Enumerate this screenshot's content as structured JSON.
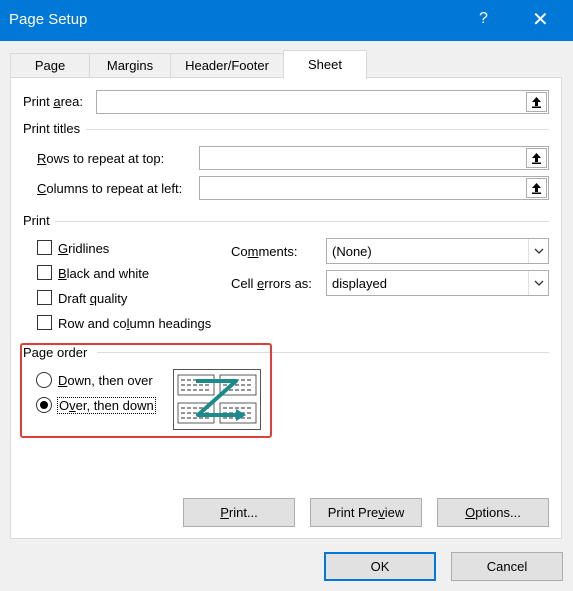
{
  "window": {
    "title": "Page Setup",
    "help_label": "?",
    "close_label": "✕",
    "help_icon": "question-mark-icon",
    "close_icon": "close-icon"
  },
  "tabs": [
    {
      "label": "Page",
      "active": false
    },
    {
      "label": "Margins",
      "active": false
    },
    {
      "label": "Header/Footer",
      "active": false
    },
    {
      "label": "Sheet",
      "active": true
    }
  ],
  "print_area": {
    "label_pre": "Print ",
    "label_key": "a",
    "label_post": "rea:",
    "value": "",
    "button_icon": "collapse-dialog-icon"
  },
  "print_titles": {
    "heading": "Print titles",
    "rows": {
      "label_key": "R",
      "label_post": "ows to repeat at top:",
      "value": ""
    },
    "columns": {
      "label_key": "C",
      "label_post": "olumns to repeat at left:",
      "value": ""
    }
  },
  "print": {
    "heading": "Print",
    "gridlines": {
      "label_key": "G",
      "label_post": "ridlines",
      "checked": false
    },
    "black_white": {
      "label_key": "B",
      "label_post": "lack and white",
      "checked": false
    },
    "draft_quality": {
      "label_pre": "Draft ",
      "label_key": "q",
      "label_post": "uality",
      "checked": false
    },
    "row_col_headings": {
      "label_pre": "Row and co",
      "label_key": "l",
      "label_post": "umn headings",
      "checked": false
    },
    "comments": {
      "label_pre": "Co",
      "label_key": "m",
      "label_post": "ments:",
      "value": "(None)"
    },
    "cell_errors": {
      "label_pre": "Cell ",
      "label_key": "e",
      "label_post": "rrors as:",
      "value": "displayed"
    }
  },
  "page_order": {
    "heading": "Page order",
    "down_then_over": {
      "label_key": "D",
      "label_post": "own, then over",
      "selected": false
    },
    "over_then_down": {
      "label_pre": "O",
      "label_key": "v",
      "label_post": "er, then down",
      "selected": true
    },
    "preview_icon": "page-order-over-then-down-icon"
  },
  "buttons": {
    "print": {
      "label_key": "P",
      "label_post": "rint..."
    },
    "print_preview": {
      "label_pre": "Print Pre",
      "label_key": "v",
      "label_post": "iew"
    },
    "options": {
      "label_key": "O",
      "label_post": "ptions..."
    },
    "ok": "OK",
    "cancel": "Cancel"
  },
  "colors": {
    "titlebar": "#0078d7",
    "highlight": "#e03c3c",
    "accent_arrow": "#1a8a8a"
  }
}
